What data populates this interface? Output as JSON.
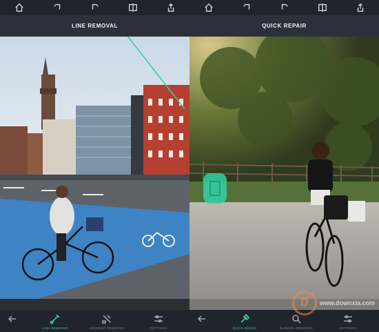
{
  "left_pane": {
    "title": "LINE REMOVAL",
    "tools": [
      {
        "icon": "back-arrow-icon",
        "label": ""
      },
      {
        "icon": "line-remover-icon",
        "label": "LINE REMOVER",
        "active": true
      },
      {
        "icon": "segment-remover-icon",
        "label": "SEGMENT REMOVER",
        "active": false
      },
      {
        "icon": "settings-sliders-icon",
        "label": "SETTINGS",
        "active": false
      }
    ]
  },
  "right_pane": {
    "title": "QUICK REPAIR",
    "tools": [
      {
        "icon": "back-arrow-icon",
        "label": ""
      },
      {
        "icon": "quick-brush-icon",
        "label": "QUICK BRUSH",
        "active": true
      },
      {
        "icon": "blemish-remover-icon",
        "label": "BLEMISH REMOVER",
        "active": false
      },
      {
        "icon": "settings-sliders-icon",
        "label": "SETTINGS",
        "active": false
      }
    ]
  },
  "top_toolbar_icons": [
    "home-icon",
    "undo-icon",
    "redo-icon",
    "compare-icon",
    "share-icon"
  ],
  "colors": {
    "accent": "#2fd3a4",
    "bar_background": "#1f242d",
    "title_background": "#2d323c"
  },
  "watermark": {
    "text": "www.downxia.com",
    "logo_glyph": "D"
  }
}
